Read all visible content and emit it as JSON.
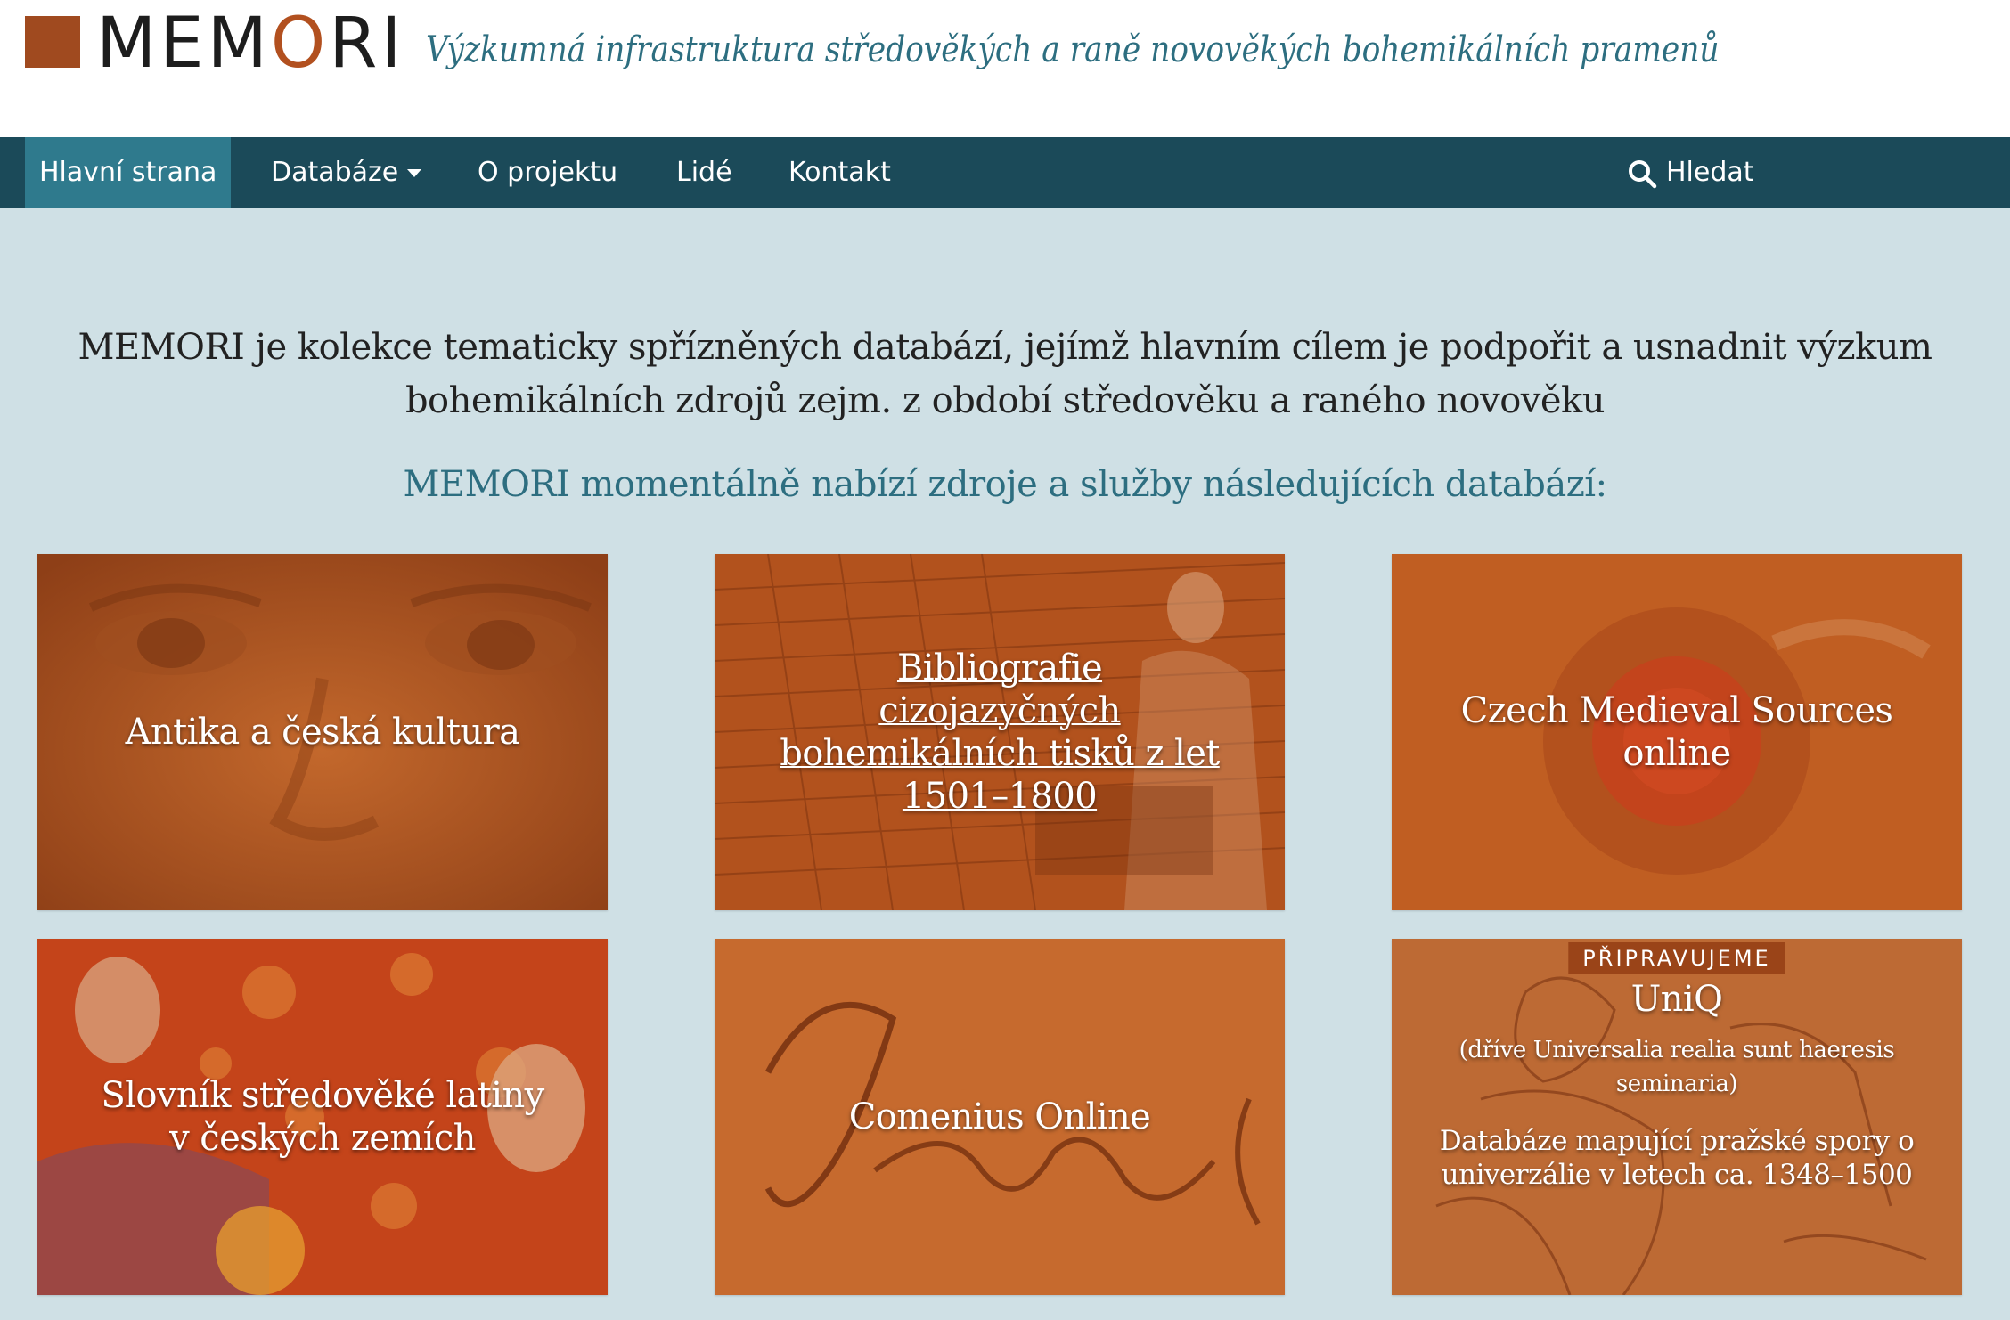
{
  "header": {
    "logo_text_start": "MEM",
    "logo_text_o": "O",
    "logo_text_end": "RI",
    "tagline": "Výzkumná infrastruktura středověkých a raně novověkých bohemikálních pramenů",
    "logo_color": "#a04a1f",
    "tagline_color": "#2d6e80"
  },
  "nav": {
    "items": [
      {
        "label": "Hlavní strana",
        "active": true
      },
      {
        "label": "Databáze",
        "dropdown": true
      },
      {
        "label": "O projektu"
      },
      {
        "label": "Lidé"
      },
      {
        "label": "Kontakt"
      }
    ],
    "search_label": "Hledat",
    "search_icon": "search-icon",
    "background": "#1b4a59",
    "active_background": "#2f7a8d"
  },
  "intro": {
    "line1": "MEMORI je kolekce tematicky spřízněných databází, jejímž hlavním cílem je podpořit a usnadnit výzkum",
    "line2": "bohemikálních zdrojů zejm. z období středověku a raného novověku",
    "subheading": "MEMORI momentálně nabízí zdroje a služby následujících databází:"
  },
  "cards": [
    {
      "title": "Antika a česká kultura"
    },
    {
      "title_lines": [
        "Bibliografie",
        "cizojazyčných",
        "bohemikálních tisků z let",
        "1501–1800"
      ],
      "link": true
    },
    {
      "title_lines": [
        "Czech Medieval Sources",
        "online"
      ]
    },
    {
      "title_lines": [
        "Slovník středověké latiny",
        "v českých zemích"
      ]
    },
    {
      "title": "Comenius Online"
    },
    {
      "badge": "PŘIPRAVUJEME",
      "title": "UniQ",
      "subtitle": "(dříve Universalia realia sunt haeresis seminaria)",
      "description": "Databáze mapující pražské spory o univerzálie v letech ca. 1348–1500"
    }
  ],
  "colors": {
    "page_background": "#cfe0e5",
    "card_orange": "#b8581f",
    "badge": "#9a4418"
  }
}
